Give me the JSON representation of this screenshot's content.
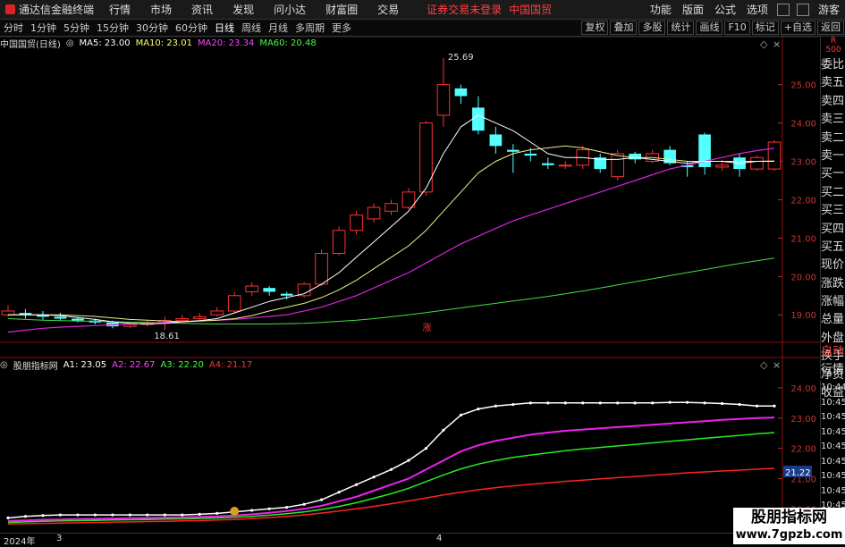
{
  "menubar": {
    "app_title": "通达信金融终端",
    "items": [
      "行情",
      "市场",
      "资讯",
      "发现",
      "问小达",
      "财富圈",
      "交易"
    ],
    "warning": "证券交易未登录",
    "stock_name": "中国国贸",
    "right_items": [
      "功能",
      "版面",
      "公式",
      "选项",
      "游客"
    ]
  },
  "toolbar": {
    "periods": [
      "分时",
      "1分钟",
      "5分钟",
      "15分钟",
      "30分钟",
      "60分钟",
      "日线",
      "周线",
      "月线",
      "多周期",
      "更多"
    ],
    "active_period": "日线",
    "right_buttons": [
      "复权",
      "叠加",
      "多股",
      "统计",
      "画线",
      "F10",
      "标记",
      "+自选",
      "返回"
    ]
  },
  "main_chart": {
    "title": "中国国贸(日线)",
    "ma": [
      {
        "label": "MA5: 23.00",
        "color": "#ffffff"
      },
      {
        "label": "MA10: 23.01",
        "color": "#ffff66"
      },
      {
        "label": "MA20: 23.34",
        "color": "#ff44ff"
      },
      {
        "label": "MA60: 20.48",
        "color": "#44ff44"
      }
    ],
    "high_label": "25.69",
    "low_label": "18.61",
    "zhang_label": "涨",
    "y_ticks": [
      "25.00",
      "24.00",
      "23.00",
      "22.00",
      "21.00",
      "20.00",
      "19.00"
    ]
  },
  "sub_chart": {
    "title": "股朋指标网",
    "lines": [
      {
        "label": "A1: 23.05",
        "color": "#ffffff"
      },
      {
        "label": "A2: 22.67",
        "color": "#ff44ff"
      },
      {
        "label": "A3: 22.20",
        "color": "#44ff44"
      },
      {
        "label": "A4: 21.17",
        "color": "#ff3333"
      }
    ],
    "y_ticks": [
      "24.00",
      "23.00",
      "22.00",
      "21.00",
      "20.00"
    ],
    "crosshair_value": "21.22"
  },
  "right_panel": {
    "top": "R",
    "sub": "500",
    "items": [
      "委比",
      "卖五",
      "卖四",
      "卖三",
      "卖二",
      "卖一",
      "买一",
      "买二",
      "买三",
      "买四",
      "买五",
      "现价",
      "涨跌",
      "涨幅",
      "总量",
      "外盘",
      "换手",
      "净资",
      "收益"
    ],
    "items2": [
      "自动",
      "行情"
    ],
    "times": [
      "10:44",
      "10:45",
      "10:45",
      "10:45",
      "10:45",
      "10:45",
      "10:45",
      "10:45",
      "10:45"
    ]
  },
  "bottom": {
    "year": "2024年",
    "m1": "3",
    "m2": "4"
  },
  "watermark": {
    "line1": "股朋指标网",
    "line2": "www.7gpzb.com"
  },
  "chart_data": {
    "type": "candlestick",
    "ylim": [
      18.4,
      25.9
    ],
    "candles": [
      {
        "o": 19.0,
        "c": 19.1,
        "h": 19.25,
        "l": 18.95
      },
      {
        "o": 19.05,
        "c": 19.0,
        "h": 19.15,
        "l": 18.9
      },
      {
        "o": 19.0,
        "c": 18.95,
        "h": 19.1,
        "l": 18.85
      },
      {
        "o": 18.95,
        "c": 18.9,
        "h": 19.05,
        "l": 18.85
      },
      {
        "o": 18.9,
        "c": 18.85,
        "h": 18.95,
        "l": 18.8
      },
      {
        "o": 18.85,
        "c": 18.8,
        "h": 18.9,
        "l": 18.75
      },
      {
        "o": 18.8,
        "c": 18.7,
        "h": 18.85,
        "l": 18.65
      },
      {
        "o": 18.7,
        "c": 18.75,
        "h": 18.8,
        "l": 18.65
      },
      {
        "o": 18.75,
        "c": 18.8,
        "h": 18.85,
        "l": 18.7
      },
      {
        "o": 18.8,
        "c": 18.85,
        "h": 18.95,
        "l": 18.61
      },
      {
        "o": 18.85,
        "c": 18.9,
        "h": 19.0,
        "l": 18.8
      },
      {
        "o": 18.9,
        "c": 18.95,
        "h": 19.05,
        "l": 18.85
      },
      {
        "o": 19.0,
        "c": 19.1,
        "h": 19.2,
        "l": 18.95
      },
      {
        "o": 19.1,
        "c": 19.5,
        "h": 19.6,
        "l": 19.05
      },
      {
        "o": 19.6,
        "c": 19.75,
        "h": 19.85,
        "l": 19.5
      },
      {
        "o": 19.7,
        "c": 19.6,
        "h": 19.75,
        "l": 19.5
      },
      {
        "o": 19.55,
        "c": 19.5,
        "h": 19.6,
        "l": 19.4
      },
      {
        "o": 19.5,
        "c": 19.8,
        "h": 19.85,
        "l": 19.45
      },
      {
        "o": 19.8,
        "c": 20.6,
        "h": 20.7,
        "l": 19.75
      },
      {
        "o": 20.6,
        "c": 21.2,
        "h": 21.3,
        "l": 20.55
      },
      {
        "o": 21.2,
        "c": 21.6,
        "h": 21.7,
        "l": 21.1
      },
      {
        "o": 21.5,
        "c": 21.8,
        "h": 21.9,
        "l": 21.4
      },
      {
        "o": 21.7,
        "c": 21.9,
        "h": 22.0,
        "l": 21.6
      },
      {
        "o": 21.8,
        "c": 22.2,
        "h": 22.3,
        "l": 21.75
      },
      {
        "o": 22.2,
        "c": 24.0,
        "h": 24.05,
        "l": 22.1
      },
      {
        "o": 24.2,
        "c": 25.0,
        "h": 25.69,
        "l": 23.9
      },
      {
        "o": 24.9,
        "c": 24.7,
        "h": 25.0,
        "l": 24.5
      },
      {
        "o": 24.4,
        "c": 23.8,
        "h": 24.7,
        "l": 23.7
      },
      {
        "o": 23.7,
        "c": 23.4,
        "h": 23.9,
        "l": 23.2
      },
      {
        "o": 23.3,
        "c": 23.25,
        "h": 23.45,
        "l": 22.7
      },
      {
        "o": 23.2,
        "c": 23.15,
        "h": 23.35,
        "l": 23.0
      },
      {
        "o": 22.95,
        "c": 22.9,
        "h": 23.1,
        "l": 22.8
      },
      {
        "o": 22.9,
        "c": 22.9,
        "h": 23.0,
        "l": 22.8
      },
      {
        "o": 22.9,
        "c": 23.3,
        "h": 23.4,
        "l": 22.8
      },
      {
        "o": 23.1,
        "c": 22.8,
        "h": 23.2,
        "l": 22.7
      },
      {
        "o": 22.6,
        "c": 23.2,
        "h": 23.3,
        "l": 22.5
      },
      {
        "o": 23.2,
        "c": 23.05,
        "h": 23.25,
        "l": 22.95
      },
      {
        "o": 23.0,
        "c": 23.2,
        "h": 23.3,
        "l": 22.95
      },
      {
        "o": 23.3,
        "c": 22.95,
        "h": 23.4,
        "l": 22.9
      },
      {
        "o": 22.9,
        "c": 22.85,
        "h": 23.0,
        "l": 22.6
      },
      {
        "o": 23.7,
        "c": 22.85,
        "h": 23.75,
        "l": 22.65
      },
      {
        "o": 22.85,
        "c": 22.9,
        "h": 23.05,
        "l": 22.75
      },
      {
        "o": 23.1,
        "c": 22.8,
        "h": 23.2,
        "l": 22.6
      },
      {
        "o": 22.8,
        "c": 23.1,
        "h": 23.15,
        "l": 22.75
      },
      {
        "o": 22.8,
        "c": 23.5,
        "h": 23.55,
        "l": 22.75
      }
    ],
    "ma5": [
      19.0,
      19.0,
      19.0,
      18.98,
      18.93,
      18.88,
      18.82,
      18.78,
      18.76,
      18.78,
      18.82,
      18.85,
      18.9,
      19.05,
      19.2,
      19.35,
      19.45,
      19.55,
      19.8,
      20.1,
      20.5,
      20.9,
      21.3,
      21.7,
      22.3,
      23.2,
      23.9,
      24.2,
      24.0,
      23.8,
      23.5,
      23.2,
      23.1,
      23.1,
      23.05,
      23.05,
      23.1,
      23.05,
      23.0,
      22.95,
      23.0,
      23.0,
      22.95,
      23.0,
      23.0
    ],
    "ma10": [
      19.0,
      19.0,
      19.0,
      19.0,
      18.98,
      18.96,
      18.92,
      18.88,
      18.86,
      18.84,
      18.82,
      18.84,
      18.86,
      18.9,
      18.98,
      19.1,
      19.2,
      19.3,
      19.45,
      19.65,
      19.9,
      20.2,
      20.5,
      20.8,
      21.2,
      21.7,
      22.2,
      22.7,
      23.0,
      23.2,
      23.3,
      23.35,
      23.4,
      23.35,
      23.25,
      23.15,
      23.1,
      23.1,
      23.05,
      23.0,
      23.0,
      23.0,
      23.0,
      23.0,
      23.01
    ],
    "ma20": [
      18.55,
      18.6,
      18.65,
      18.68,
      18.7,
      18.72,
      18.74,
      18.76,
      18.78,
      18.8,
      18.82,
      18.84,
      18.86,
      18.88,
      18.92,
      18.96,
      19.0,
      19.1,
      19.2,
      19.35,
      19.5,
      19.7,
      19.9,
      20.1,
      20.35,
      20.6,
      20.85,
      21.05,
      21.25,
      21.45,
      21.6,
      21.75,
      21.9,
      22.05,
      22.2,
      22.35,
      22.5,
      22.65,
      22.8,
      22.9,
      23.0,
      23.1,
      23.2,
      23.28,
      23.34
    ],
    "ma60": [
      18.9,
      18.88,
      18.86,
      18.85,
      18.84,
      18.83,
      18.82,
      18.81,
      18.8,
      18.79,
      18.78,
      18.77,
      18.76,
      18.76,
      18.76,
      18.76,
      18.77,
      18.78,
      18.8,
      18.83,
      18.86,
      18.9,
      18.95,
      19.0,
      19.06,
      19.12,
      19.18,
      19.24,
      19.3,
      19.36,
      19.42,
      19.48,
      19.55,
      19.62,
      19.7,
      19.78,
      19.86,
      19.94,
      20.02,
      20.1,
      20.18,
      20.26,
      20.34,
      20.41,
      20.48
    ],
    "sub_ylim": [
      19.3,
      24.5
    ],
    "a1": [
      19.7,
      19.75,
      19.78,
      19.8,
      19.8,
      19.8,
      19.8,
      19.8,
      19.8,
      19.8,
      19.8,
      19.82,
      19.85,
      19.9,
      19.95,
      20.0,
      20.05,
      20.15,
      20.3,
      20.55,
      20.8,
      21.05,
      21.3,
      21.6,
      22.0,
      22.6,
      23.1,
      23.3,
      23.4,
      23.45,
      23.5,
      23.5,
      23.5,
      23.5,
      23.5,
      23.5,
      23.5,
      23.5,
      23.52,
      23.52,
      23.5,
      23.48,
      23.45,
      23.4,
      23.4
    ],
    "a2": [
      19.6,
      19.62,
      19.64,
      19.65,
      19.66,
      19.67,
      19.68,
      19.69,
      19.7,
      19.71,
      19.72,
      19.73,
      19.75,
      19.78,
      19.82,
      19.87,
      19.93,
      20.0,
      20.1,
      20.25,
      20.4,
      20.6,
      20.8,
      21.0,
      21.3,
      21.6,
      21.9,
      22.1,
      22.25,
      22.35,
      22.45,
      22.52,
      22.58,
      22.62,
      22.66,
      22.7,
      22.74,
      22.78,
      22.82,
      22.86,
      22.9,
      22.94,
      22.97,
      23.0,
      23.02
    ],
    "a3": [
      19.55,
      19.57,
      19.59,
      19.6,
      19.61,
      19.62,
      19.63,
      19.64,
      19.65,
      19.66,
      19.67,
      19.68,
      19.7,
      19.72,
      19.75,
      19.79,
      19.84,
      19.9,
      19.98,
      20.08,
      20.2,
      20.35,
      20.5,
      20.68,
      20.9,
      21.12,
      21.32,
      21.48,
      21.6,
      21.7,
      21.78,
      21.85,
      21.92,
      21.98,
      22.03,
      22.08,
      22.13,
      22.18,
      22.23,
      22.28,
      22.33,
      22.38,
      22.43,
      22.48,
      22.52
    ],
    "a4": [
      19.5,
      19.51,
      19.52,
      19.53,
      19.54,
      19.55,
      19.56,
      19.57,
      19.58,
      19.59,
      19.6,
      19.61,
      19.63,
      19.65,
      19.68,
      19.71,
      19.75,
      19.8,
      19.86,
      19.93,
      20.0,
      20.08,
      20.17,
      20.26,
      20.36,
      20.46,
      20.55,
      20.63,
      20.7,
      20.76,
      20.81,
      20.86,
      20.91,
      20.95,
      20.99,
      21.03,
      21.07,
      21.11,
      21.15,
      21.19,
      21.22,
      21.25,
      21.28,
      21.31,
      21.34
    ]
  }
}
